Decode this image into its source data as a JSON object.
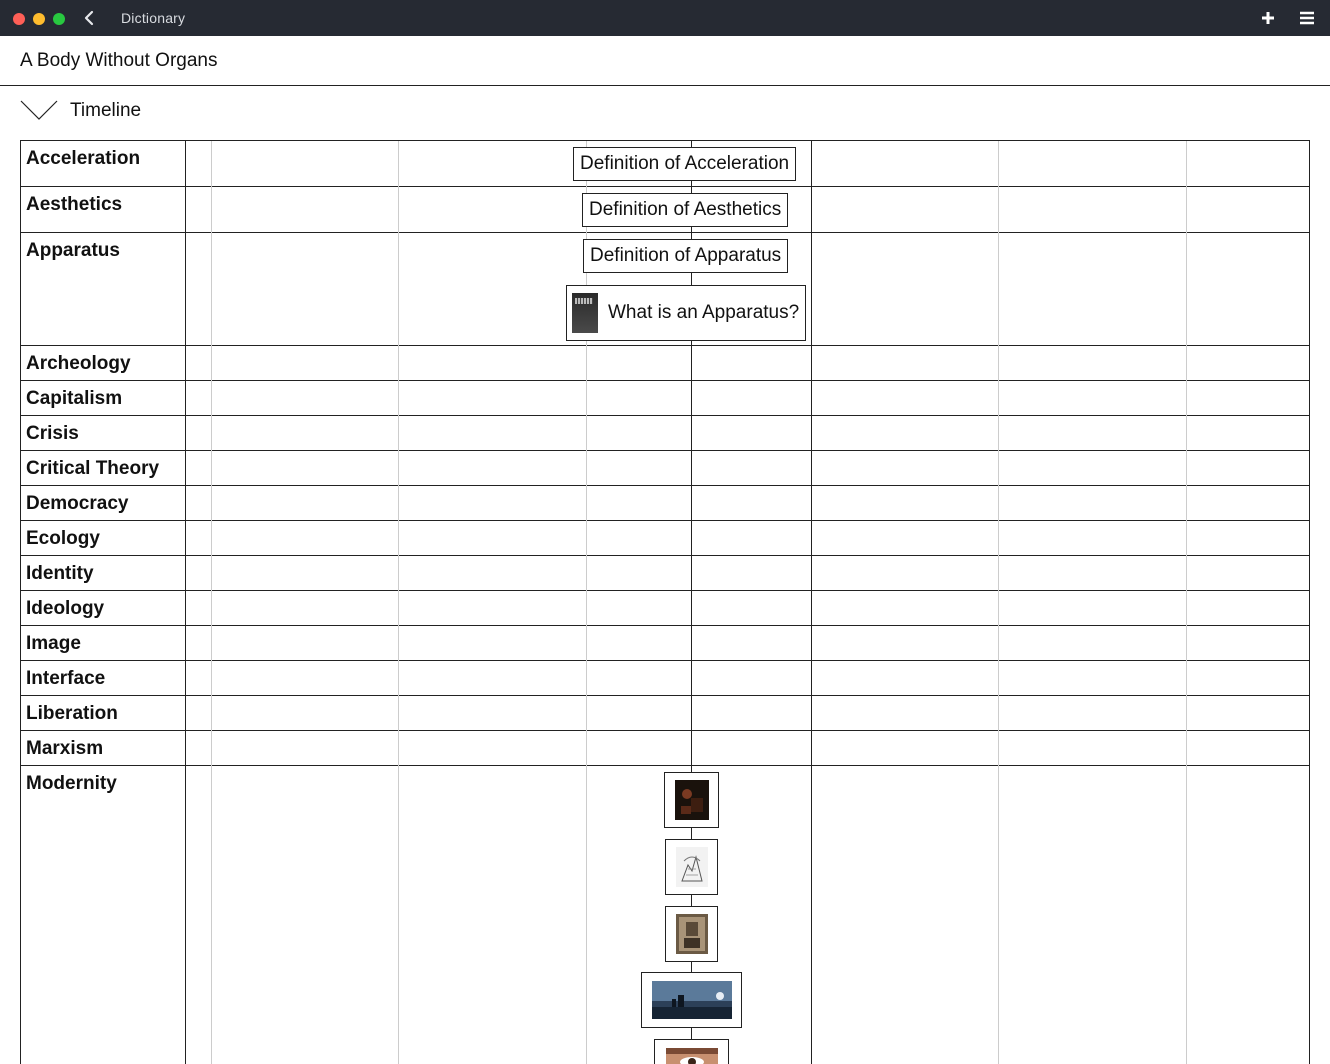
{
  "window": {
    "title": "Dictionary"
  },
  "document": {
    "title": "A Body Without Organs"
  },
  "timeline": {
    "label": "Timeline",
    "expanded": true
  },
  "rows": [
    {
      "label": "Acceleration"
    },
    {
      "label": "Aesthetics"
    },
    {
      "label": "Apparatus"
    },
    {
      "label": "Archeology"
    },
    {
      "label": "Capitalism"
    },
    {
      "label": "Crisis"
    },
    {
      "label": "Critical Theory"
    },
    {
      "label": "Democracy"
    },
    {
      "label": "Ecology"
    },
    {
      "label": "Identity"
    },
    {
      "label": "Ideology"
    },
    {
      "label": "Image"
    },
    {
      "label": "Interface"
    },
    {
      "label": "Liberation"
    },
    {
      "label": "Marxism"
    },
    {
      "label": "Modernity"
    }
  ],
  "entries": {
    "acceleration_definition": "Definition of Acceleration",
    "aesthetics_definition": "Definition of Aesthetics",
    "apparatus_definition": "Definition of Apparatus",
    "apparatus_book": "What is an Apparatus?"
  },
  "icons": {
    "back": "chevron-left-icon",
    "add": "plus-icon",
    "menu": "hamburger-menu-icon",
    "timeline_toggle": "chevron-down-icon"
  },
  "colors": {
    "titlebar": "#262a33",
    "close": "#fe5f57",
    "minimize": "#febc2e",
    "maximize": "#28c840"
  }
}
